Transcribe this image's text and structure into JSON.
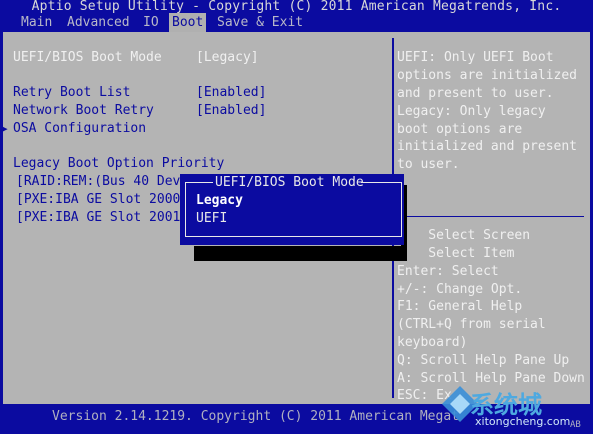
{
  "header": {
    "title": "Aptio Setup Utility - Copyright (C) 2011 American Megatrends, Inc."
  },
  "tabs": [
    {
      "label": "Main",
      "active": false
    },
    {
      "label": "Advanced",
      "active": false
    },
    {
      "label": "IO",
      "active": false
    },
    {
      "label": "Boot",
      "active": true
    },
    {
      "label": "Save & Exit",
      "active": false
    }
  ],
  "settings": {
    "boot_mode_label": "UEFI/BIOS Boot Mode",
    "boot_mode_value": "[Legacy]",
    "retry_boot_list_label": "Retry Boot List",
    "retry_boot_list_value": "[Enabled]",
    "network_boot_retry_label": "Network Boot Retry",
    "network_boot_retry_value": "[Enabled]",
    "osa_config_label": "OSA Configuration",
    "legacy_priority_label": "Legacy Boot Option Priority",
    "boot_options": [
      "[RAID:REM:(Bus 40 Dev",
      "[PXE:IBA GE Slot 2000",
      "[PXE:IBA GE Slot 2001"
    ]
  },
  "help": {
    "lines": [
      "UEFI: Only UEFI Boot",
      "options are initialized",
      "and present to user.",
      "Legacy: Only legacy",
      "boot options are",
      "initialized and present",
      "to user."
    ]
  },
  "keys": {
    "lines": [
      "    Select Screen",
      "    Select Item",
      "Enter: Select",
      "+/-: Change Opt.",
      "F1: General Help",
      "(CTRL+Q from serial",
      "keyboard)",
      "Q: Scroll Help Pane Up",
      "A: Scroll Help Pane Down",
      "ESC: Ex"
    ]
  },
  "popup": {
    "title": "UEFI/BIOS Boot Mode",
    "options": [
      "Legacy",
      "UEFI"
    ],
    "selected": "Legacy"
  },
  "footer": {
    "version": "Version 2.14.1219. Copyright (C) 2011 American Megat",
    "corner": "AB"
  },
  "watermark": {
    "brand": "系统城",
    "url": "xitongcheng.com"
  },
  "colors": {
    "bios_blue": "#0b0ba0",
    "panel_gray": "#b4b4b4",
    "text_white": "#f0f0f0"
  }
}
